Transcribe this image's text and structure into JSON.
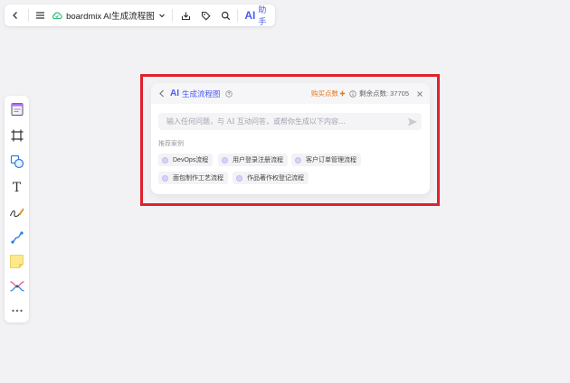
{
  "topbar": {
    "doc_title": "boardmix AI生成流程图",
    "ai_text": "AI",
    "ai_label": "助手",
    "icons": [
      "back-icon",
      "menu-icon",
      "cloud-sync-icon",
      "chevron-down-icon",
      "download-icon",
      "tag-icon",
      "search-icon"
    ]
  },
  "leftbar": {
    "tools": [
      "template-icon",
      "frame-icon",
      "shape-icon",
      "text-icon",
      "pen-icon",
      "connector-icon",
      "sticky-note-icon",
      "mindmap-icon",
      "more-icon"
    ],
    "text_tool_label": "T"
  },
  "panel": {
    "ai_text": "AI",
    "title": "生成流程图",
    "buy_label": "购买点数",
    "remaining_label": "剩余点数: 37705",
    "input_placeholder": "输入任何问题，与 AI 互动问答，或帮你生成以下内容...",
    "recommend_title": "推荐案例",
    "chips": [
      "DevOps流程",
      "用户登录注册流程",
      "客户订单管理流程",
      "面包制作工艺流程",
      "作品著作权登记流程"
    ]
  },
  "colors": {
    "accent": "#4a5bf2",
    "buy": "#e07a1f",
    "highlight": "#e0212b",
    "canvas": "#f2f2f5"
  }
}
